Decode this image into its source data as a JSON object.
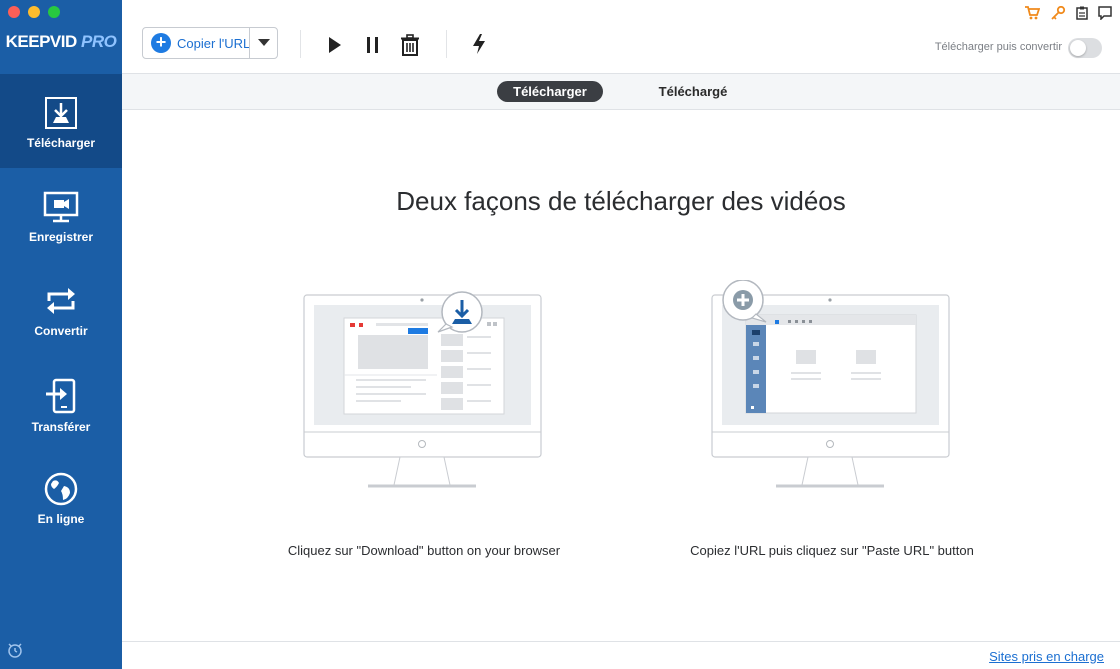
{
  "app": {
    "logo_main": "KEEPVID",
    "logo_pro": "PRO"
  },
  "colors": {
    "sidebar": "#1b5ea6",
    "sidebar_active": "#134a88",
    "accent": "#1e7be2",
    "link": "#1b6fd1",
    "cart_icon": "#f08a1c",
    "key_icon": "#f08a1c"
  },
  "sidebar": {
    "items": [
      {
        "label": "Télécharger",
        "icon": "download-icon",
        "active": true
      },
      {
        "label": "Enregistrer",
        "icon": "screen-record-icon",
        "active": false
      },
      {
        "label": "Convertir",
        "icon": "convert-icon",
        "active": false
      },
      {
        "label": "Transférer",
        "icon": "transfer-icon",
        "active": false
      },
      {
        "label": "En ligne",
        "icon": "globe-icon",
        "active": false
      }
    ],
    "bottom_icon": "alarm-clock-icon"
  },
  "toolbar": {
    "copy_url_label": "Copier l'URL",
    "icons": [
      "play-icon",
      "pause-icon",
      "trash-icon",
      "lightning-icon"
    ],
    "top_right_icons": [
      "cart-icon",
      "key-icon",
      "clipboard-icon",
      "chat-icon"
    ],
    "convert_toggle_label": "Télécharger puis convertir",
    "convert_toggle_on": false
  },
  "tabs": [
    {
      "label": "Télécharger",
      "active": true
    },
    {
      "label": "Téléchargé",
      "active": false
    }
  ],
  "main": {
    "heading": "Deux façons de télécharger des vidéos",
    "method1_caption": "Cliquez sur \"Download\" button on your browser",
    "method2_caption": "Copiez l'URL puis cliquez sur \"Paste URL\" button"
  },
  "footer": {
    "supported_sites_link": "Sites pris en charge"
  }
}
